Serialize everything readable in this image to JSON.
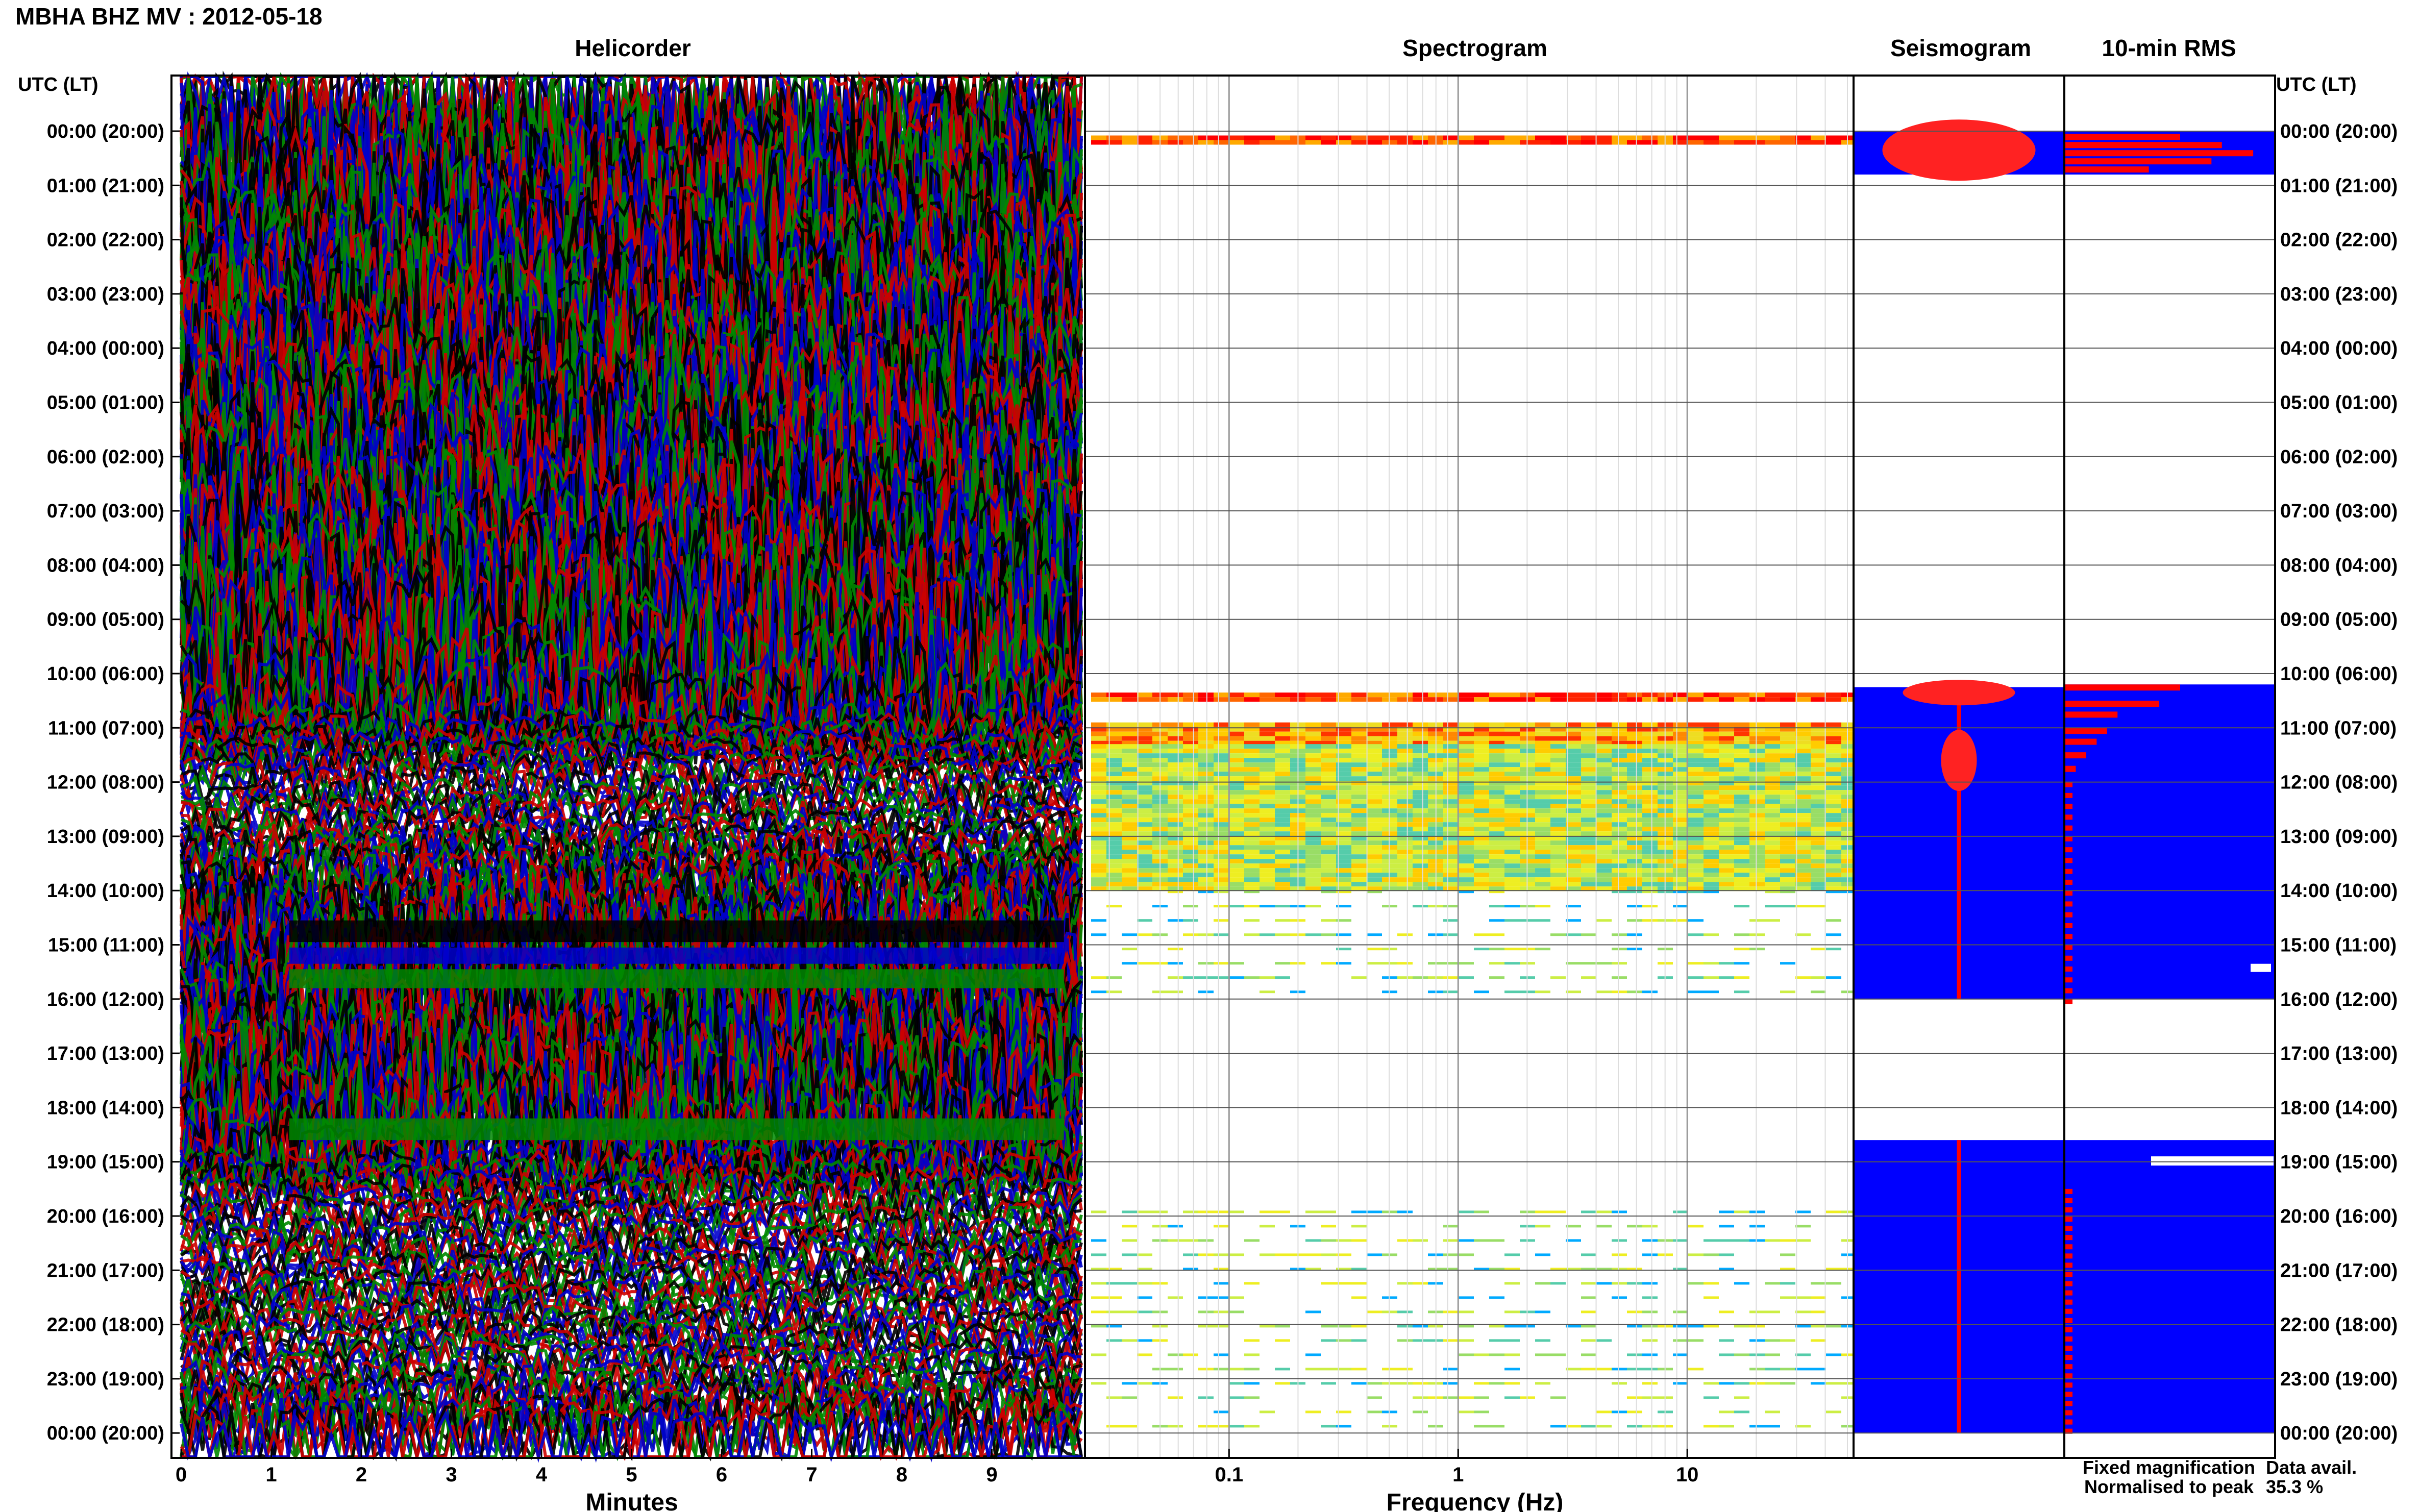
{
  "chart_data": [
    {
      "type": "line",
      "panel": "helicorder",
      "title": "MBHA BHZ MV : 2012-05-18",
      "subtitle": "Helicorder",
      "xlabel": "Minutes",
      "x_ticks": [
        "0",
        "1",
        "2",
        "3",
        "4",
        "5",
        "6",
        "7",
        "8",
        "9"
      ],
      "xlim": [
        0,
        10
      ],
      "ylabel": "UTC (LT)",
      "ylabel_right": "UTC (LT)",
      "y_ticks": [
        "00:00 (20:00)",
        "01:00 (21:00)",
        "02:00 (22:00)",
        "03:00 (23:00)",
        "04:00 (00:00)",
        "05:00 (01:00)",
        "06:00 (02:00)",
        "07:00 (03:00)",
        "08:00 (04:00)",
        "09:00 (05:00)",
        "10:00 (06:00)",
        "11:00 (07:00)",
        "12:00 (08:00)",
        "13:00 (09:00)",
        "14:00 (10:00)",
        "15:00 (11:00)",
        "16:00 (12:00)",
        "17:00 (13:00)",
        "18:00 (14:00)",
        "19:00 (15:00)",
        "20:00 (16:00)",
        "21:00 (17:00)",
        "22:00 (18:00)",
        "23:00 (19:00)",
        "00:00 (20:00)"
      ],
      "trace_colors": [
        "#000000",
        "#cc0000",
        "#0000cc",
        "#008800"
      ],
      "noise_level_by_hour": [
        2.2,
        2.2,
        2.2,
        2.2,
        2.2,
        2.2,
        2.2,
        2.2,
        2.2,
        2.2,
        2.0,
        0.35,
        0.35,
        0.35,
        0.8,
        1.3,
        1.6,
        1.6,
        1.6,
        0.5,
        0.35,
        0.35,
        0.35,
        0.35,
        0.7
      ]
    },
    {
      "type": "heatmap",
      "panel": "spectrogram",
      "title": "Spectrogram",
      "xlabel": "Frequency (Hz)",
      "x_scale": "log",
      "x_ticks": [
        "0.1",
        "1",
        "10"
      ],
      "xlim": [
        0.025,
        50
      ],
      "bands": [
        {
          "start_hour": 0.08,
          "end_hour": 0.2,
          "intensity": "high"
        },
        {
          "start_hour": 10.35,
          "end_hour": 10.5,
          "intensity": "high"
        },
        {
          "start_hour": 10.9,
          "end_hour": 11.3,
          "intensity": "medium"
        },
        {
          "start_hour": 11.3,
          "end_hour": 14.0,
          "intensity": "low-medium"
        },
        {
          "start_hour": 14.0,
          "end_hour": 16.0,
          "intensity": "sparse"
        },
        {
          "start_hour": 19.9,
          "end_hour": 24.0,
          "intensity": "sparse"
        }
      ]
    },
    {
      "type": "area",
      "panel": "seismogram",
      "title": "Seismogram",
      "data_available": [
        [
          0.0,
          0.8
        ],
        [
          10.25,
          16.0
        ],
        [
          18.6,
          24.0
        ]
      ]
    },
    {
      "type": "bar",
      "panel": "rms",
      "title": "10-min RMS",
      "data_available": [
        [
          0.0,
          0.8
        ],
        [
          10.2,
          16.0
        ],
        [
          18.6,
          24.0
        ]
      ]
    }
  ],
  "legend": {
    "fixed": "Fixed magnification",
    "fixed_color": "#0000ff",
    "normalised": "Normalised to peak",
    "normalised_color": "#ff0000"
  },
  "data_avail": {
    "label": "Data avail.",
    "value": "35.3 %"
  }
}
